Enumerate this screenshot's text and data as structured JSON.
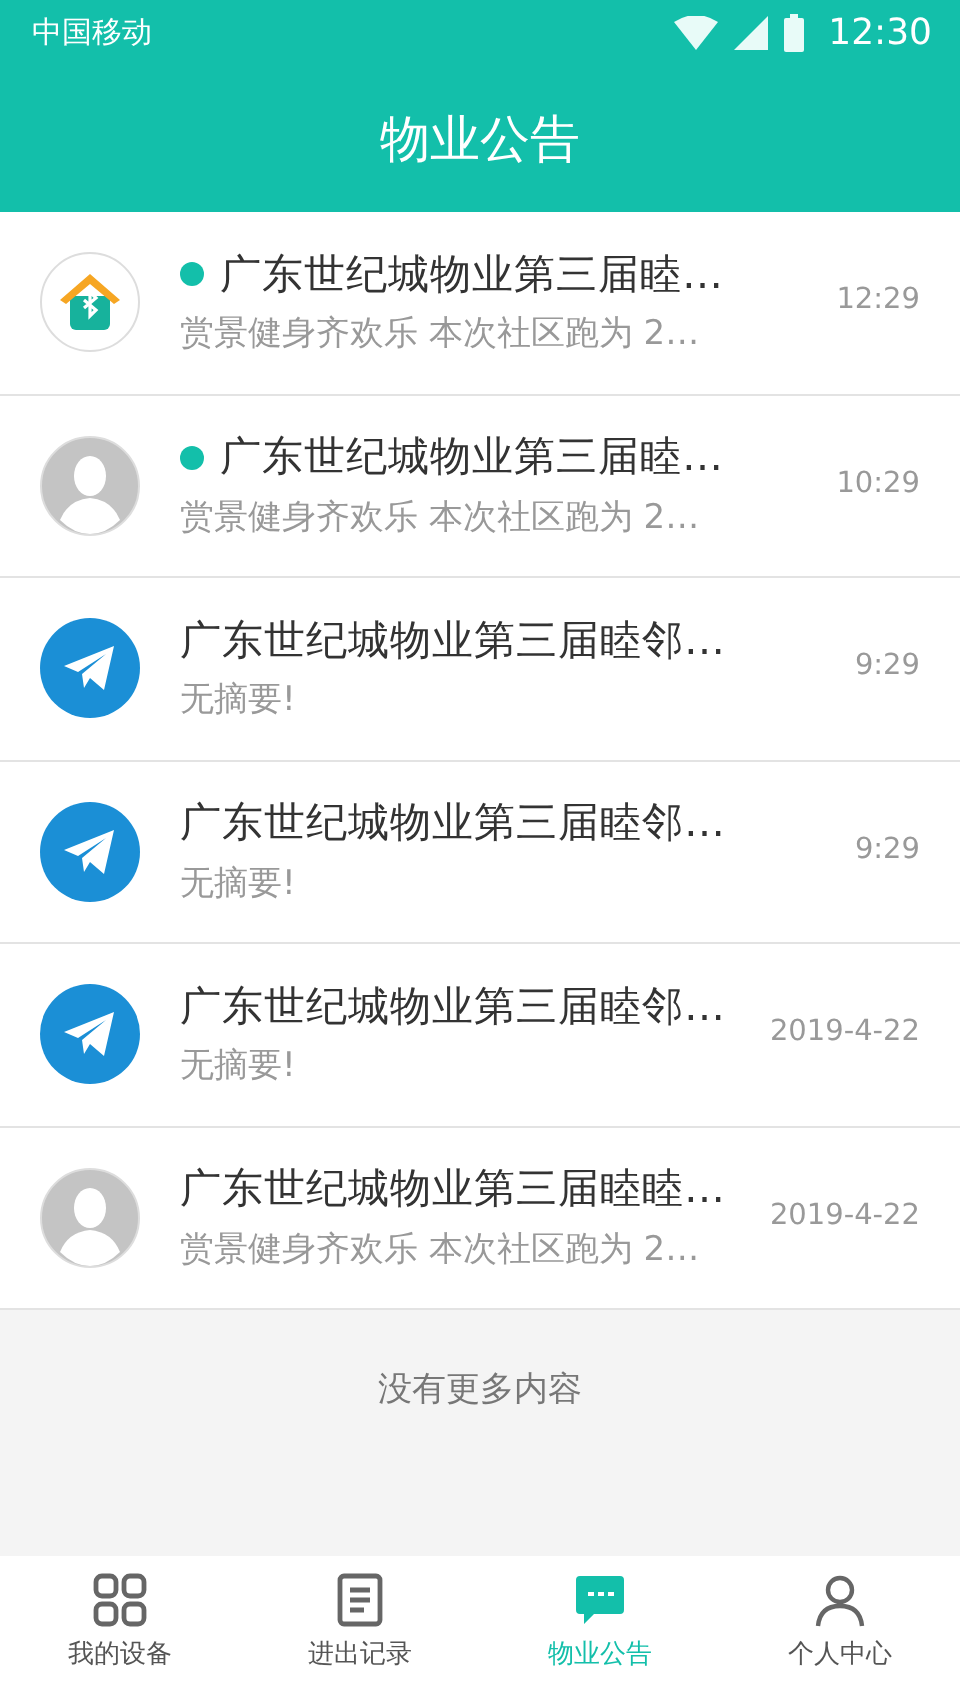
{
  "status_bar": {
    "carrier": "中国移动",
    "time": "12:30"
  },
  "header": {
    "title": "物业公告"
  },
  "notices": [
    {
      "kind": "app",
      "unread": true,
      "title": "广东世纪城物业第三届睦…",
      "summary": "赏景健身齐欢乐 本次社区跑为 2…",
      "time": "12:29"
    },
    {
      "kind": "person",
      "unread": true,
      "title": "广东世纪城物业第三届睦…",
      "summary": "赏景健身齐欢乐 本次社区跑为 2…",
      "time": "10:29"
    },
    {
      "kind": "plane",
      "unread": false,
      "title": "广东世纪城物业第三届睦邻…",
      "summary": "无摘要!",
      "time": "9:29"
    },
    {
      "kind": "plane",
      "unread": false,
      "title": "广东世纪城物业第三届睦邻…",
      "summary": "无摘要!",
      "time": "9:29"
    },
    {
      "kind": "plane",
      "unread": false,
      "title": "广东世纪城物业第三届睦邻…",
      "summary": "无摘要!",
      "time": "2019-4-22"
    },
    {
      "kind": "person",
      "unread": false,
      "title": "广东世纪城物业第三届睦睦…",
      "summary": "赏景健身齐欢乐 本次社区跑为 2…",
      "time": "2019-4-22"
    }
  ],
  "end_note": "没有更多内容",
  "tabs": [
    {
      "label": "我的设备",
      "selected": false
    },
    {
      "label": "进出记录",
      "selected": false
    },
    {
      "label": "物业公告",
      "selected": true
    },
    {
      "label": "个人中心",
      "selected": false
    }
  ]
}
